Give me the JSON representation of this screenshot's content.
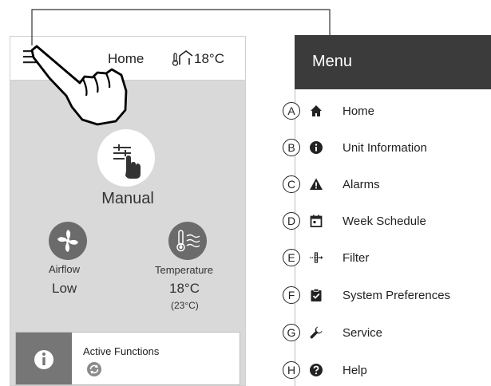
{
  "screen": {
    "title": "Home",
    "outdoor_temp": "18°C",
    "mode": "Manual",
    "airflow": {
      "label": "Airflow",
      "value": "Low"
    },
    "temperature": {
      "label": "Temperature",
      "value": "18°C",
      "setpoint": "(23°C)"
    },
    "active_functions": "Active Functions"
  },
  "menu": {
    "title": "Menu",
    "items": [
      {
        "letter": "A",
        "label": "Home",
        "icon": "home-icon"
      },
      {
        "letter": "B",
        "label": "Unit Information",
        "icon": "info-icon"
      },
      {
        "letter": "C",
        "label": "Alarms",
        "icon": "warning-icon"
      },
      {
        "letter": "D",
        "label": "Week Schedule",
        "icon": "calendar-icon"
      },
      {
        "letter": "E",
        "label": "Filter",
        "icon": "filter-icon"
      },
      {
        "letter": "F",
        "label": "System Preferences",
        "icon": "clipboard-check-icon"
      },
      {
        "letter": "G",
        "label": "Service",
        "icon": "wrench-icon"
      },
      {
        "letter": "H",
        "label": "Help",
        "icon": "help-icon"
      }
    ]
  }
}
